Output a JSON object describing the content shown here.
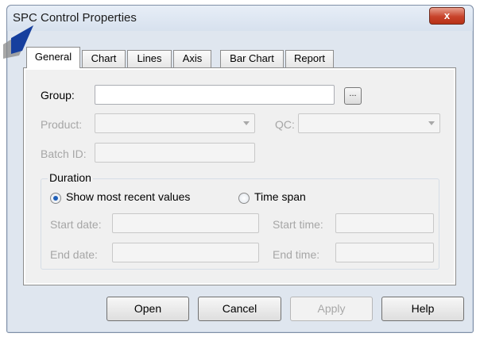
{
  "window": {
    "title": "SPC Control Properties",
    "close_label": "x"
  },
  "tabs": [
    {
      "label": "General",
      "active": true
    },
    {
      "label": "Chart"
    },
    {
      "label": "Lines"
    },
    {
      "label": "Axis"
    },
    {
      "label": "Bar Chart"
    },
    {
      "label": "Report"
    }
  ],
  "general": {
    "group_label": "Group:",
    "group_value": "",
    "browse_label": "...",
    "product_label": "Product:",
    "product_value": "",
    "qc_label": "QC:",
    "qc_value": "",
    "batch_label": "Batch ID:",
    "batch_value": ""
  },
  "duration": {
    "title": "Duration",
    "option_recent": "Show most recent values",
    "option_span": "Time span",
    "selected": "recent",
    "start_date_label": "Start date:",
    "start_time_label": "Start time:",
    "end_date_label": "End date:",
    "end_time_label": "End time:"
  },
  "buttons": {
    "open": "Open",
    "cancel": "Cancel",
    "apply": "Apply",
    "help": "Help"
  }
}
